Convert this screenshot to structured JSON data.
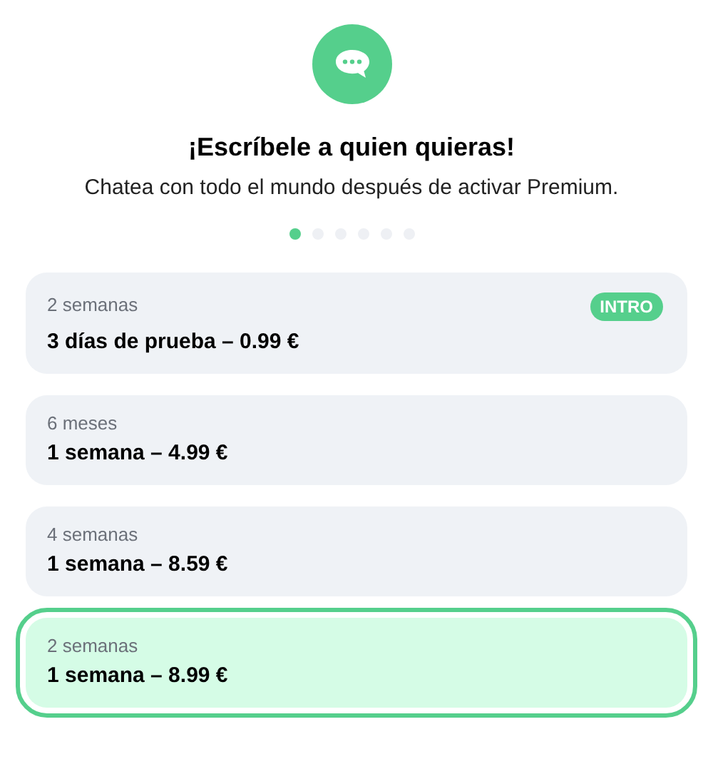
{
  "header": {
    "title": "¡Escríbele a quien quieras!",
    "subtitle": "Chatea con todo el mundo después de activar Premium."
  },
  "pager": [
    {
      "selected": true
    },
    {
      "selected": false
    },
    {
      "selected": false
    },
    {
      "selected": false
    },
    {
      "selected": false
    },
    {
      "selected": false
    }
  ],
  "plans": [
    {
      "period": "2 semanas",
      "offer": "3 días de prueba – 0.99 €",
      "badge": "INTRO",
      "selected": false
    },
    {
      "period": "6 meses",
      "offer": "1 semana – 4.99 €",
      "selected": false
    },
    {
      "period": "4 semanas",
      "offer": "1 semana – 8.59 €",
      "selected": false
    },
    {
      "period": "2 semanas",
      "offer": "1 semana – 8.99 €",
      "selected": true
    }
  ]
}
